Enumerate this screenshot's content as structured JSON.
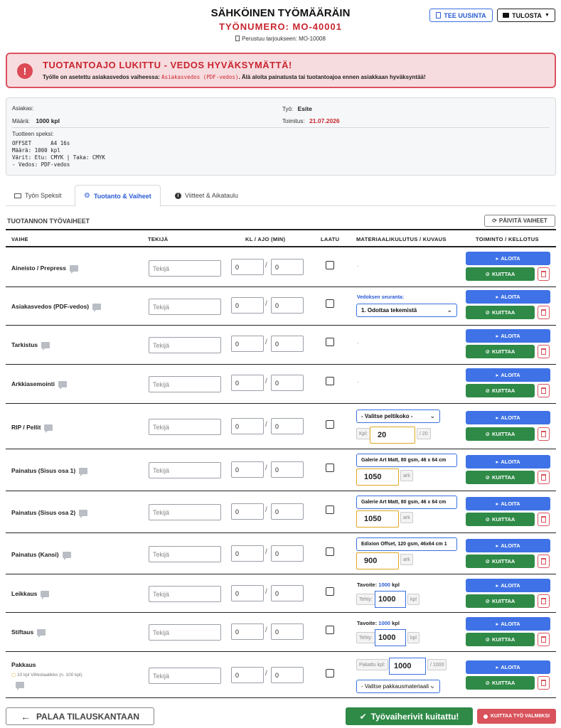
{
  "header": {
    "title": "SÄHKÖINEN TYÖMÄÄRÄIN",
    "job_number": "TYÖNUMERO: MO-40001",
    "based_on": "Perustuu tarjoukseen: MO-10008",
    "new_button": "TEE UUSINTA",
    "print_button": "TULOSTA"
  },
  "alert": {
    "title": "TUOTANTOAJO LUKITTU - VEDOS HYVÄKSYMÄTTÄ!",
    "text_before": "Työlle on asetettu asiakasvedos vaiheessa:",
    "code": "Asiakasvedos (PDF-vedos)",
    "text_after": ". Älä aloita painatusta tai tuotantoajoa ennen asiakkaan hyväksyntää!"
  },
  "info": {
    "customer_label": "Asiakas:",
    "customer_value": "",
    "quantity_label": "Määrä:",
    "quantity_value": "1000 kpl",
    "job_label": "Työ:",
    "job_value": "Esite",
    "delivery_label": "Toimitus:",
    "delivery_value": "21.07.2026",
    "spec_label": "Tuotteen speksi:",
    "spec_text": "OFFSET      A4 16s\nMäärä: 1000 kpl\nVärit: Etu: CMYK | Taka: CMYK\n- Vedos: PDF-vedos"
  },
  "tabs": [
    "Työn Speksit",
    "Tuotanto & Vaiheet",
    "Viitteet & Aikataulu"
  ],
  "section": {
    "title": "TUOTANNON TYÖVAIHEET",
    "refresh_button": "PÄIVITÄ VAIHEET"
  },
  "table": {
    "headers": [
      "VAIHE",
      "TEKIJÄ",
      "KL / AJO (MIN)",
      "LAATU",
      "MATERIAALIKULUTUS / KUVAUS",
      "TOIMINTO / KELLOTUS"
    ],
    "worker_placeholder": "Tekijä",
    "start_label": "ALOITA",
    "ack_label": "KUITTAA",
    "rows": [
      {
        "name": "Aineisto / Prepress",
        "kl": "0",
        "ajo": "0",
        "material": "-"
      },
      {
        "name": "Asiakasvedos (PDF-vedos)",
        "kl": "0",
        "ajo": "0",
        "material_label": "Vedoksen seuranta:",
        "material_select": "1. Odottaa tekemistä"
      },
      {
        "name": "Tarkistus",
        "kl": "0",
        "ajo": "0",
        "material": "-"
      },
      {
        "name": "Arkkiasemointi",
        "kl": "0",
        "ajo": "0",
        "material": "-"
      },
      {
        "name": "RIP / Pellit",
        "kl": "0",
        "ajo": "0",
        "material_select": "- Valitse peltikoko -",
        "plates_prefix": "Kpl:",
        "plates_value": "20",
        "plates_suffix": "/ 20"
      },
      {
        "name": "Painatus (Sisus osa 1)",
        "kl": "0",
        "ajo": "0",
        "material_select": "Galerie Art Matt, 80 gsm, 46 x 64 cm",
        "sheets_value": "1050",
        "sheets_unit": "ark"
      },
      {
        "name": "Painatus (Sisus osa 2)",
        "kl": "0",
        "ajo": "0",
        "material_select": "Galerie Art Matt, 80 gsm, 46 x 64 cm",
        "sheets_value": "1050",
        "sheets_unit": "ark"
      },
      {
        "name": "Painatus (Kansi)",
        "kl": "0",
        "ajo": "0",
        "material_select": "Edixion Offset, 120 gsm, 46x64 cm 1",
        "sheets_value": "900",
        "sheets_unit": "ark"
      },
      {
        "name": "Leikkaus",
        "kl": "0",
        "ajo": "0",
        "target_label": "Tavoite:",
        "target_value": "1000",
        "target_unit": "kpl",
        "done_prefix": "Tehty:",
        "done_value": "1000",
        "done_unit": "kpl"
      },
      {
        "name": "Stiftaus",
        "kl": "0",
        "ajo": "0",
        "target_label": "Tavoite:",
        "target_value": "1000",
        "target_unit": "kpl",
        "done_prefix": "Tehty:",
        "done_value": "1000",
        "done_unit": "kpl"
      },
      {
        "name": "Pakkaus",
        "note": "10 kpl Vihkolaatikko (n. 100 kpl)",
        "kl": "0",
        "ajo": "0",
        "packed_prefix": "Pakattu kpl:",
        "packed_value": "1000",
        "packed_suffix": "/ 1000",
        "material_select": "- Valitse pakkausmateriaali -"
      }
    ]
  },
  "footer": {
    "back_button": "PALAA TILAUSKANTAAN",
    "done_button": "Työvaiherivit kuitattu!",
    "finish_button": "KUITTAA TYÖ VALMIIKSI"
  }
}
